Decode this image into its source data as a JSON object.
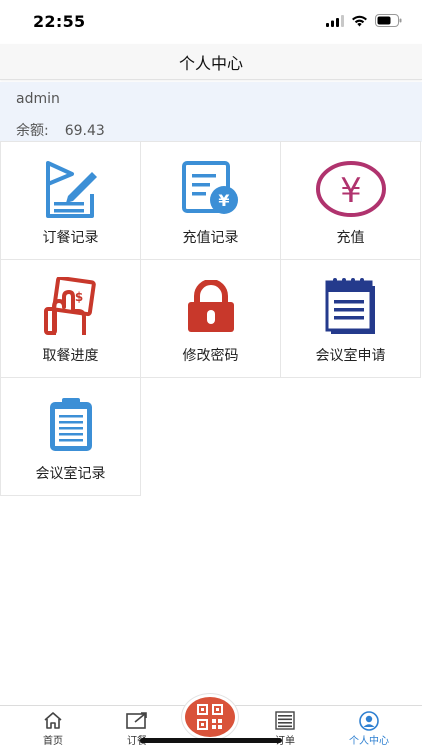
{
  "status_bar": {
    "time": "22:55"
  },
  "header": {
    "title": "个人中心"
  },
  "user": {
    "name": "admin",
    "balance_label": "余额:",
    "balance_value": "69.43"
  },
  "menu": [
    {
      "label": "订餐记录",
      "icon": "order-record-icon",
      "color": "#3c8fd6"
    },
    {
      "label": "充值记录",
      "icon": "recharge-record-icon",
      "color": "#3c8fd6"
    },
    {
      "label": "充值",
      "icon": "yuan-icon",
      "color": "#b0336e"
    },
    {
      "label": "取餐进度",
      "icon": "pickup-progress-icon",
      "color": "#c8382b"
    },
    {
      "label": "修改密码",
      "icon": "lock-icon",
      "color": "#c8382b"
    },
    {
      "label": "会议室申请",
      "icon": "notepad-icon",
      "color": "#243a8c"
    },
    {
      "label": "会议室记录",
      "icon": "clipboard-icon",
      "color": "#3c8fd6"
    }
  ],
  "tabs": [
    {
      "label": "首页",
      "icon": "home-icon"
    },
    {
      "label": "订餐",
      "icon": "order-icon"
    },
    {
      "label": "订单",
      "icon": "list-icon"
    },
    {
      "label": "个人中心",
      "icon": "profile-icon",
      "active": true
    }
  ],
  "colors": {
    "accent": "#2f80d1",
    "scan_button": "#d9533a",
    "panel_bg": "#eef3fb"
  }
}
